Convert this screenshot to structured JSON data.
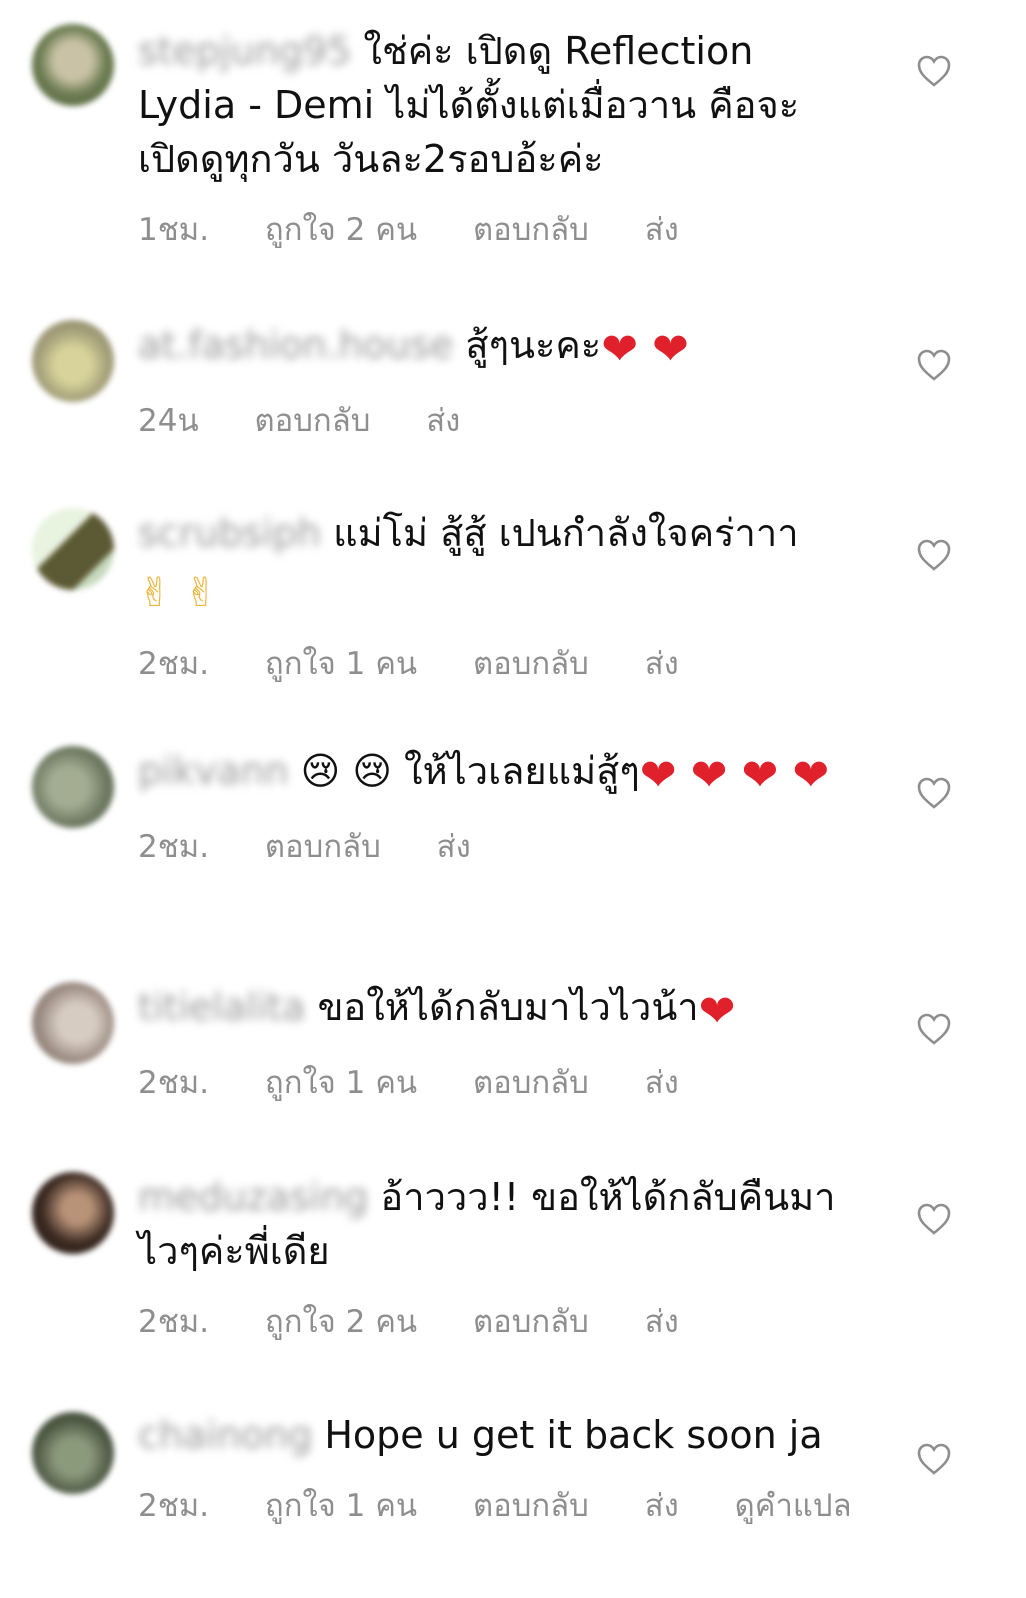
{
  "comments": [
    {
      "username": "stepjung95",
      "text": "ใช่ค่ะ เปิดดู Reflection Lydia - Demi  ไม่ได้ตั้งแต่เมื่อวาน คือจะเปิดดูทุกวัน วันละ2รอบอ้ะค่ะ",
      "emoji": "",
      "time": "1ชม.",
      "likes": "ถูกใจ 2 คน",
      "reply": "ตอบกลับ",
      "send": "ส่ง",
      "translate": "",
      "avatar_color": "#6d7d52"
    },
    {
      "username": "at.fashion.house",
      "text": "สู้ๆนะคะ",
      "emoji": "❤ ❤",
      "time": "24น",
      "likes": "",
      "reply": "ตอบกลับ",
      "send": "ส่ง",
      "translate": "",
      "avatar_color": "#a8a37c"
    },
    {
      "username": "scrubsiph",
      "text": "แม่โม่ สู้สู้ เปนกำลังใจคร่าาา",
      "emoji": "✌ ✌",
      "time": "2ชม.",
      "likes": "ถูกใจ 1 คน",
      "reply": "ตอบกลับ",
      "send": "ส่ง",
      "translate": "",
      "avatar_color": "#5c5a34"
    },
    {
      "username": "pikvann",
      "text": "😢 😢 ให้ไวเลยแม่สู้ๆ",
      "emoji": "❤ ❤ ❤ ❤",
      "time": "2ชม.",
      "likes": "",
      "reply": "ตอบกลับ",
      "send": "ส่ง",
      "translate": "",
      "avatar_color": "#6f7b63"
    },
    {
      "username": "titielalita",
      "text": "ขอให้ได้กลับมาไวไวน้า",
      "emoji": "❤",
      "time": "2ชม.",
      "likes": "ถูกใจ 1 คน",
      "reply": "ตอบกลับ",
      "send": "ส่ง",
      "translate": "",
      "avatar_color": "#9e8f85"
    },
    {
      "username": "meduzasing",
      "text": "อ้าววว!! ขอให้ได้กลับคืนมาไวๆค่ะพี่เดีย",
      "emoji": "",
      "time": "2ชม.",
      "likes": "ถูกใจ 2 คน",
      "reply": "ตอบกลับ",
      "send": "ส่ง",
      "translate": "",
      "avatar_color": "#3b2a22"
    },
    {
      "username": "chainong",
      "text": "Hope u get it back soon ja",
      "emoji": "",
      "time": "2ชม.",
      "likes": "ถูกใจ 1 คน",
      "reply": "ตอบกลับ",
      "send": "ส่ง",
      "translate": "ดูคำแปล",
      "avatar_color": "#4e5a45"
    }
  ],
  "icons": {
    "like": "heart-outline-icon"
  }
}
